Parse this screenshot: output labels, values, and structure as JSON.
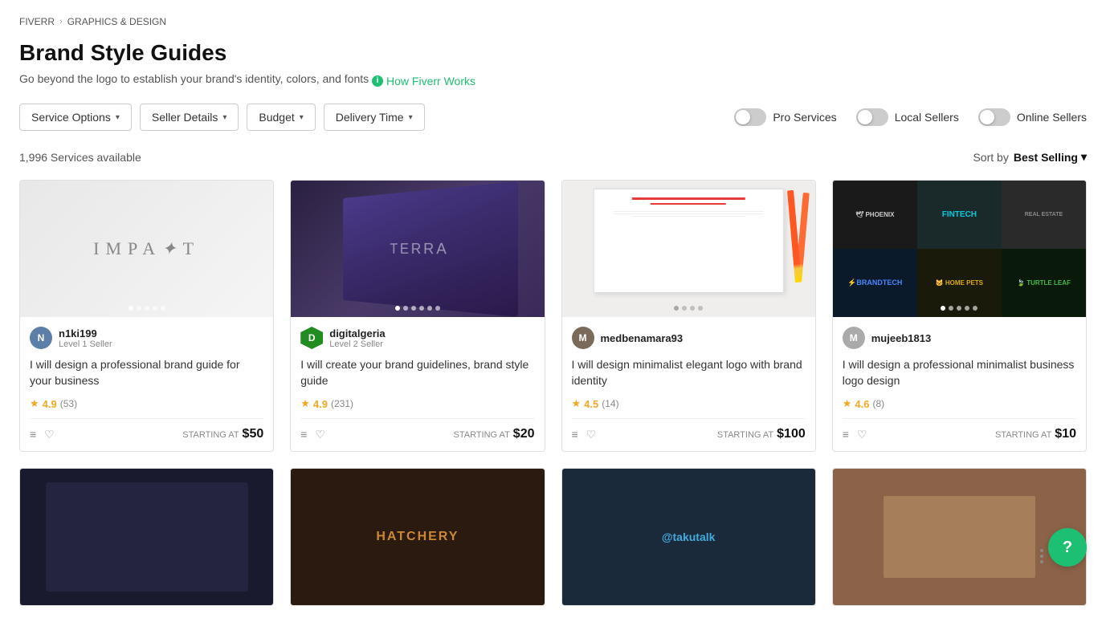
{
  "breadcrumb": {
    "items": [
      "FIVERR",
      "GRAPHICS & DESIGN"
    ]
  },
  "page": {
    "title": "Brand Style Guides",
    "subtitle": "Go beyond the logo to establish your brand's identity, colors, and fonts",
    "how_link": "How Fiverr Works"
  },
  "filters": {
    "service_options": "Service Options",
    "seller_details": "Seller Details",
    "budget": "Budget",
    "delivery_time": "Delivery Time"
  },
  "toggles": {
    "pro_services": "Pro Services",
    "local_sellers": "Local Sellers",
    "online_sellers": "Online Sellers"
  },
  "results": {
    "count": "1,996 Services available",
    "sort_label": "Sort by",
    "sort_value": "Best Selling"
  },
  "cards": [
    {
      "seller_name": "n1ki199",
      "seller_level": "Level 1 Seller",
      "avatar_color": "#5b7fa6",
      "avatar_letter": "N",
      "title": "I will design a professional brand guide for your business",
      "rating": "4.9",
      "review_count": "(53)",
      "starting_at": "STARTING AT",
      "price": "$50",
      "img_type": "impact",
      "dots": [
        true,
        false,
        false,
        false,
        false
      ]
    },
    {
      "seller_name": "digitalgeria",
      "seller_level": "Level 2 Seller",
      "avatar_color": "#8b4513",
      "avatar_letter": "D",
      "avatar_shape": "shield",
      "title": "I will create your brand guidelines, brand style guide",
      "rating": "4.9",
      "review_count": "(231)",
      "starting_at": "STARTING AT",
      "price": "$20",
      "img_type": "book",
      "dots": [
        true,
        false,
        false,
        false,
        false,
        false
      ]
    },
    {
      "seller_name": "medbenamara93",
      "seller_level": "",
      "avatar_color": "#5a5a5a",
      "avatar_letter": "M",
      "title": "I will design minimalist elegant logo with brand identity",
      "rating": "4.5",
      "review_count": "(14)",
      "starting_at": "STARTING AT",
      "price": "$100",
      "img_type": "stationery",
      "dots": [
        true,
        false,
        false,
        false
      ]
    },
    {
      "seller_name": "mujeeb1813",
      "seller_level": "",
      "avatar_color": "#888",
      "avatar_letter": "M",
      "title": "I will design a professional minimalist business logo design",
      "rating": "4.6",
      "review_count": "(8)",
      "starting_at": "STARTING AT",
      "price": "$10",
      "img_type": "logos",
      "dots": [
        true,
        false,
        false,
        false,
        false
      ]
    }
  ]
}
